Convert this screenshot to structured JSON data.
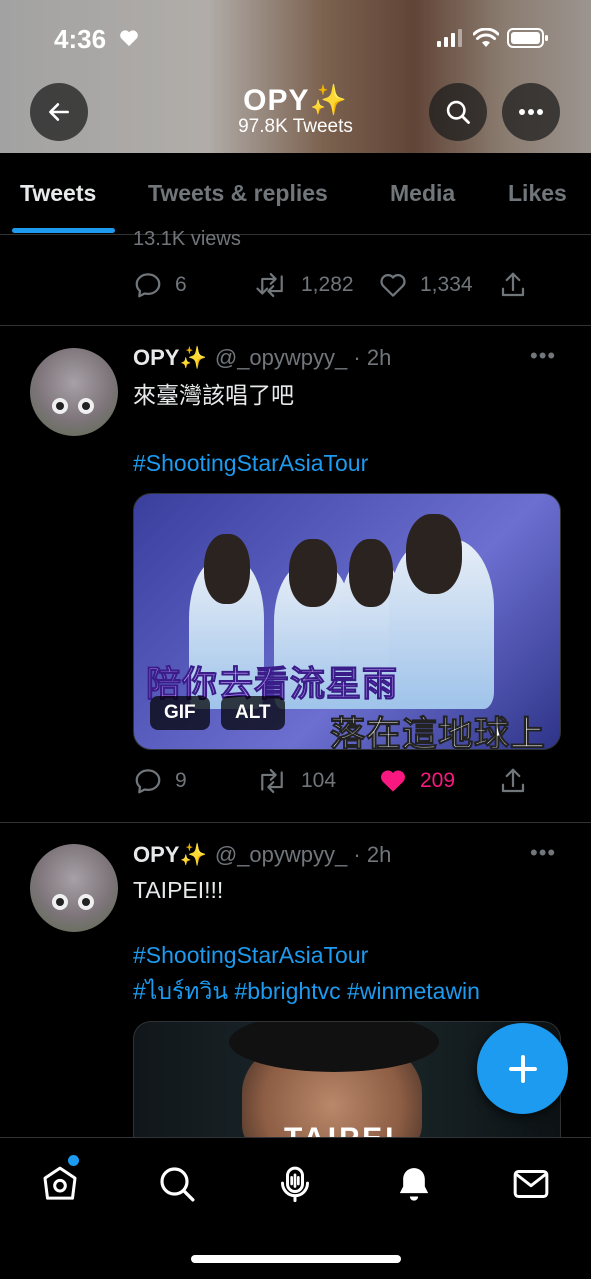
{
  "status_bar": {
    "time": "4:36"
  },
  "header": {
    "title": "OPY✨",
    "tweet_count": "97.8K Tweets"
  },
  "tabs": [
    {
      "label": "Tweets",
      "active": true
    },
    {
      "label": "Tweets & replies",
      "active": false
    },
    {
      "label": "Media",
      "active": false
    },
    {
      "label": "Likes",
      "active": false
    }
  ],
  "prev_tweet": {
    "views": "13.1K views",
    "replies": "6",
    "retweets": "1,282",
    "likes": "1,334"
  },
  "tweets": [
    {
      "display_name": "OPY✨",
      "handle": "@_opywpyy_",
      "time": "· 2h",
      "text": "來臺灣該唱了吧",
      "hashtags_line1": "#ShootingStarAsiaTour",
      "media": {
        "subtitle1": "陪你去看流星雨",
        "subtitle2": "落在這地球上",
        "gif_badge": "GIF",
        "alt_badge": "ALT"
      },
      "replies": "9",
      "retweets": "104",
      "likes": "209",
      "liked": true
    },
    {
      "display_name": "OPY✨",
      "handle": "@_opywpyy_",
      "time": "· 2h",
      "text": "TAIPEI!!!",
      "hashtags_line1": "#ShootingStarAsiaTour",
      "hashtags_line2": "#ไบร์ทวิน #bbrightvc #winmetawin",
      "media": {
        "overlay_text": "TAIPEI"
      }
    }
  ],
  "colors": {
    "accent": "#1d9bf0",
    "like": "#f91880",
    "muted": "#71767b",
    "text": "#e7e9ea"
  },
  "icons": [
    "back-arrow-icon",
    "search-icon",
    "more-icon",
    "reply-icon",
    "retweet-icon",
    "like-icon",
    "share-icon",
    "home-icon",
    "explore-icon",
    "spaces-icon",
    "notifications-icon",
    "messages-icon",
    "compose-icon"
  ]
}
